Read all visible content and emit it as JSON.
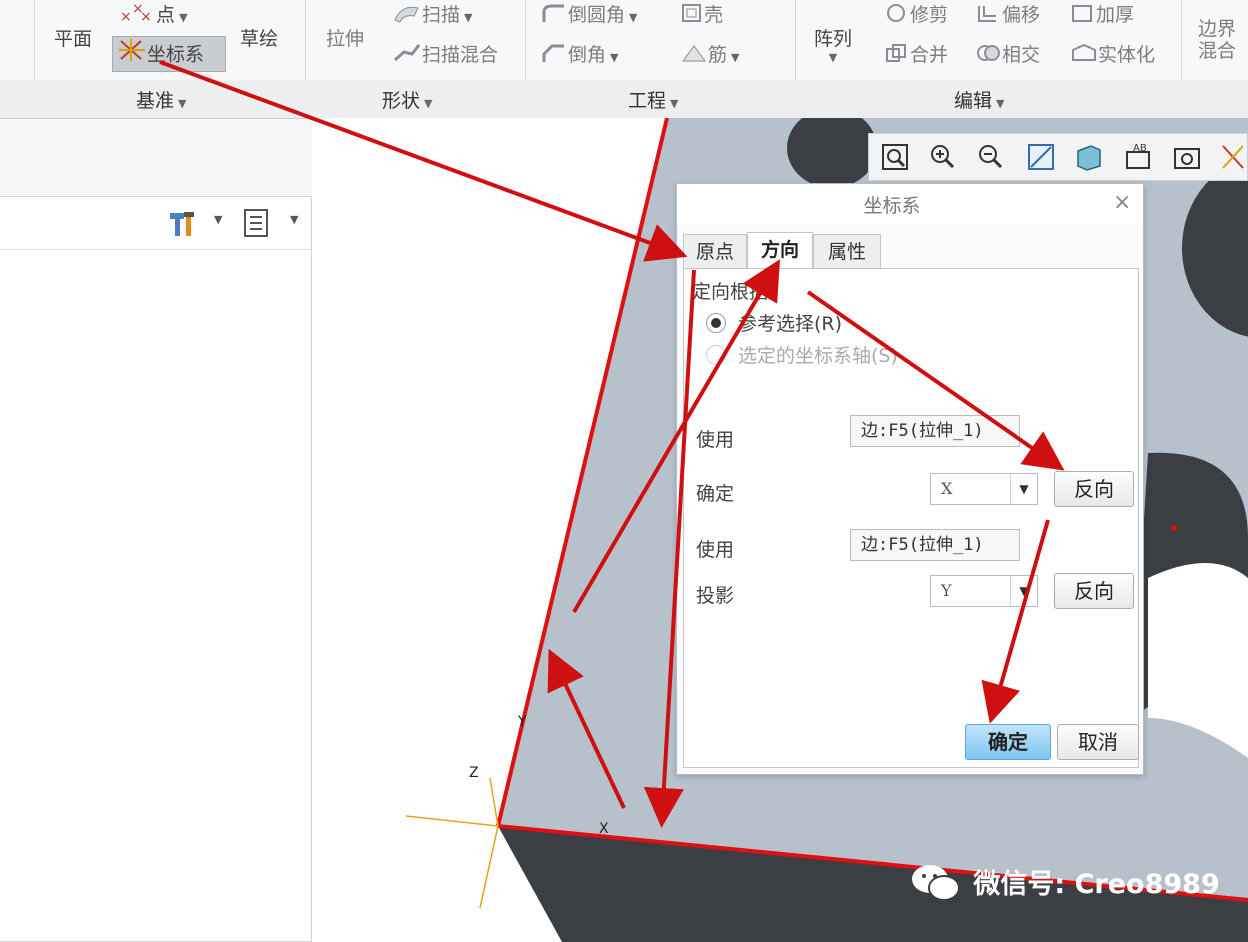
{
  "ribbon": {
    "plane": "平面",
    "point": "点",
    "csys": "坐标系",
    "sketch": "草绘",
    "extrude": "拉伸",
    "sweep": "扫描",
    "swept_blend": "扫描混合",
    "round": "倒圆角",
    "chamfer": "倒角",
    "shell": "壳",
    "rib": "筋",
    "pattern": "阵列",
    "trim": "修剪",
    "offset": "偏移",
    "thicken": "加厚",
    "merge": "合并",
    "intersect": "相交",
    "solidify": "实体化",
    "boundary_blend_1": "边界",
    "boundary_blend_2": "混合"
  },
  "groups": {
    "datum": "基准",
    "shapes": "形状",
    "engineering": "工程",
    "editing": "编辑"
  },
  "dialog": {
    "title": "坐标系",
    "tabs": [
      "原点",
      "方向",
      "属性"
    ],
    "orient_by": "定向根据",
    "opt_ref": "参考选择(R)",
    "opt_axes": "选定的坐标系轴(S)",
    "use_label": "使用",
    "determine_label": "确定",
    "project_label": "投影",
    "ref1": "边:F5(拉伸_1)",
    "ref2": "边:F5(拉伸_1)",
    "axis1": "X",
    "axis2": "Y",
    "flip": "反向",
    "ok": "确定",
    "cancel": "取消"
  },
  "triad": {
    "z": "Z",
    "x": "X",
    "y": "Y"
  },
  "watermark": "微信号: Creo8989",
  "colors": {
    "annotation_red": "#d01010",
    "dark_solid": "#3b3f44",
    "model_face": "#b7c1cb"
  }
}
